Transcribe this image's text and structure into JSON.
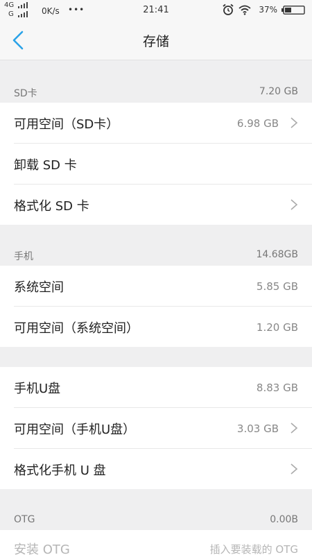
{
  "status_bar": {
    "network_top": "4G",
    "network_bottom": "G",
    "speed": "0K/s",
    "dots": "•••",
    "time": "21:41",
    "battery_percent": "37%"
  },
  "title_bar": {
    "title": "存储"
  },
  "sections": {
    "sd": {
      "label": "SD卡",
      "value": "7.20 GB",
      "rows": [
        {
          "label": "可用空间（SD卡）",
          "value": "6.98 GB"
        },
        {
          "label": "卸载 SD 卡",
          "value": ""
        },
        {
          "label": "格式化 SD 卡",
          "value": ""
        }
      ]
    },
    "phone": {
      "label": "手机",
      "value": "14.68GB",
      "rows": [
        {
          "label": "系统空间",
          "value": "5.85 GB"
        },
        {
          "label": "可用空间（系统空间）",
          "value": "1.20 GB"
        }
      ]
    },
    "udisk": {
      "rows": [
        {
          "label": "手机U盘",
          "value": "8.83 GB"
        },
        {
          "label": "可用空间（手机U盘）",
          "value": "3.03 GB"
        },
        {
          "label": "格式化手机 U 盘",
          "value": ""
        }
      ]
    },
    "otg": {
      "label": "OTG",
      "value": "0.00B",
      "rows": [
        {
          "label": "安装 OTG",
          "value": "插入要装载的 OTG"
        }
      ]
    }
  },
  "colors": {
    "accent": "#2aa3e8",
    "background": "#efeff0",
    "row_background": "#ffffff",
    "secondary_text": "#888888"
  }
}
